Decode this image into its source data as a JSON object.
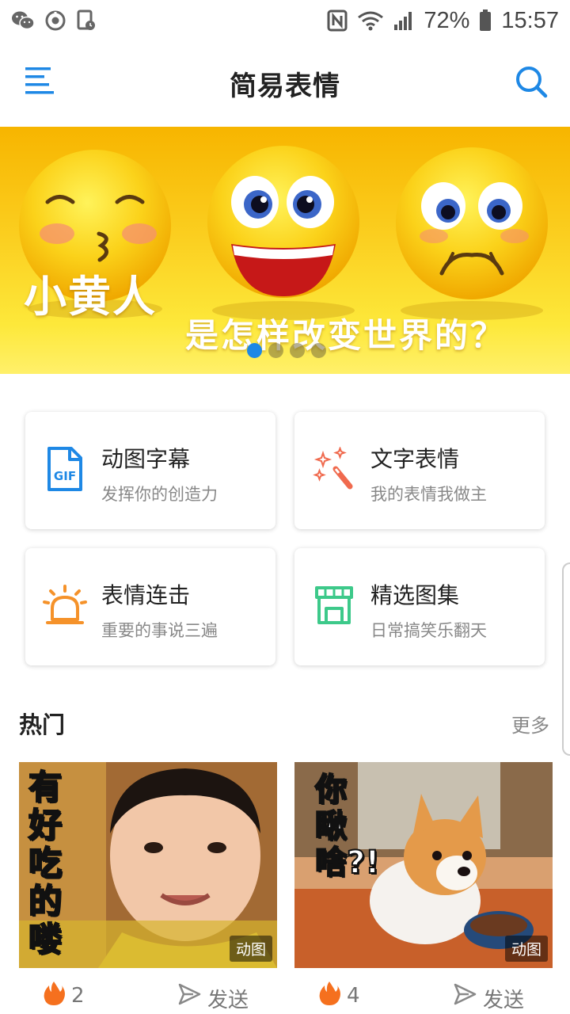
{
  "status": {
    "battery": "72%",
    "time": "15:57"
  },
  "appbar": {
    "title": "简易表情"
  },
  "banner": {
    "line1": "小黄人",
    "line2": "是怎样改变世界的？",
    "page_count": 4,
    "active_index": 0
  },
  "features": [
    {
      "title": "动图字幕",
      "subtitle": "发挥你的创造力",
      "icon": "gif-file-icon",
      "color": "#1e88e5"
    },
    {
      "title": "文字表情",
      "subtitle": "我的表情我做主",
      "icon": "magic-wand-icon",
      "color": "#f06a4e"
    },
    {
      "title": "表情连击",
      "subtitle": "重要的事说三遍",
      "icon": "alarm-light-icon",
      "color": "#f5922a"
    },
    {
      "title": "精选图集",
      "subtitle": "日常搞笑乐翻天",
      "icon": "store-icon",
      "color": "#3dc98a"
    }
  ],
  "hot": {
    "title": "热门",
    "more": "更多",
    "items": [
      {
        "caption": "有好吃的喽",
        "tag": "动图",
        "count": "2",
        "send": "发送"
      },
      {
        "caption": "你瞅啥?!",
        "tag": "动图",
        "count": "4",
        "send": "发送"
      }
    ]
  }
}
